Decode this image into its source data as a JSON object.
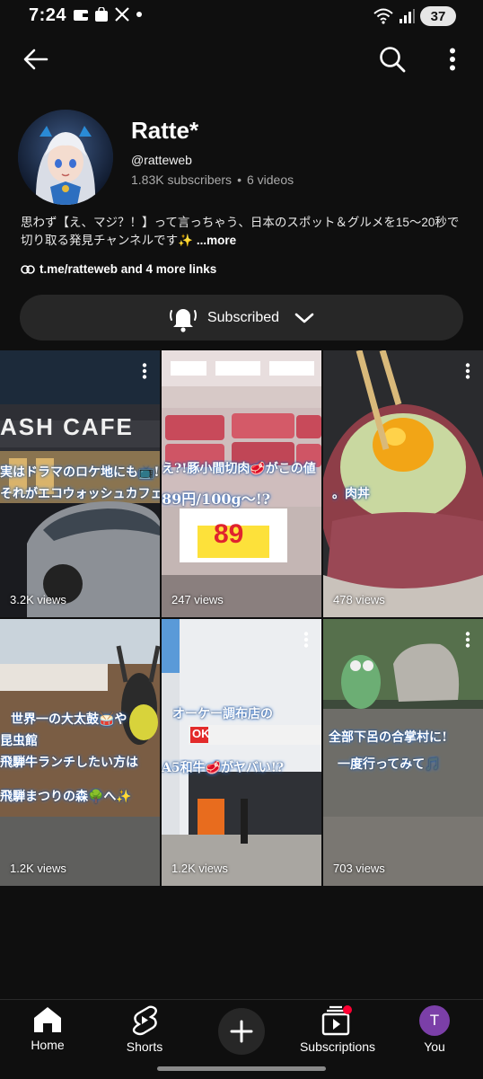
{
  "status_bar": {
    "time": "7:24",
    "battery": "37"
  },
  "channel": {
    "name": "Ratte*",
    "handle": "@ratteweb",
    "subscribers": "1.83K subscribers",
    "separator": "•",
    "videos": "6 videos",
    "description": "思わず【え、マジ？！】って言っちゃう、日本のスポット＆グルメを15〜20秒で切り取る発見チャンネルです✨",
    "more_label": "...more",
    "links_label": "t.me/ratteweb and 4 more links"
  },
  "subscribe_button": {
    "label": "Subscribed"
  },
  "videos": [
    {
      "views": "3.2K views",
      "captions": [
        "実はドラマのロケ地にも📺!?",
        "それがエコウォッシュカフェ"
      ],
      "sign": "ASH CAFE"
    },
    {
      "views": "247 views",
      "captions": [
        "え?!豚小間切肉🥩がこの値",
        "89円/100g〜!?"
      ],
      "sign": "89"
    },
    {
      "views": "478 views",
      "captions": [
        "。肉丼"
      ],
      "sign": ""
    },
    {
      "views": "1.2K views",
      "captions": [
        "世界一の大太鼓🥁や",
        "昆虫館",
        "飛騨牛ランチしたい方は",
        "飛騨まつりの森🌳へ✨"
      ],
      "sign": ""
    },
    {
      "views": "1.2K views",
      "captions": [
        "オーケー調布店の",
        "A5和牛🥩がヤバい!?"
      ],
      "sign": "OK"
    },
    {
      "views": "703 views",
      "captions": [
        "全部下呂の合掌村に!",
        "一度行ってみて🎵"
      ],
      "sign": ""
    }
  ],
  "bottom_nav": {
    "home": "Home",
    "shorts": "Shorts",
    "subscriptions": "Subscriptions",
    "you": "You",
    "you_initial": "T"
  }
}
